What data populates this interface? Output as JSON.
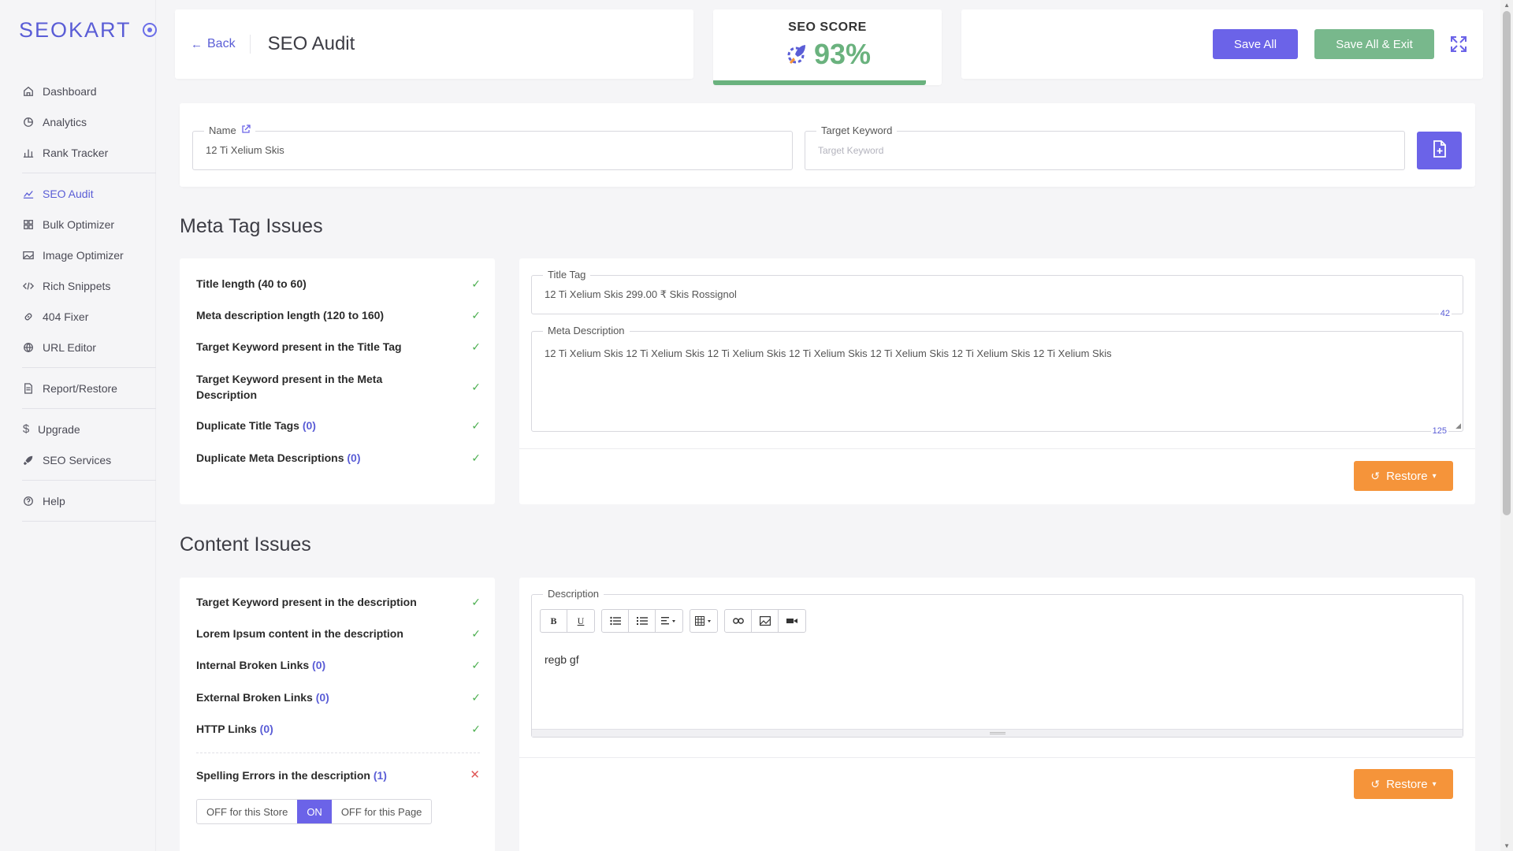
{
  "brand": {
    "logo_text": "SEOKART",
    "accent": "#6b63e8",
    "success": "#6ab27e",
    "warning": "#f5943a"
  },
  "sidebar": {
    "items": [
      {
        "label": "Dashboard",
        "icon": "home-icon"
      },
      {
        "label": "Analytics",
        "icon": "pie-chart-icon"
      },
      {
        "label": "Rank Tracker",
        "icon": "bar-chart-icon"
      },
      {
        "label": "SEO Audit",
        "icon": "line-chart-icon",
        "active": true
      },
      {
        "label": "Bulk Optimizer",
        "icon": "grid-icon"
      },
      {
        "label": "Image Optimizer",
        "icon": "image-icon"
      },
      {
        "label": "Rich Snippets",
        "icon": "code-icon"
      },
      {
        "label": "404 Fixer",
        "icon": "link-icon"
      },
      {
        "label": "URL Editor",
        "icon": "globe-icon"
      },
      {
        "label": "Report/Restore",
        "icon": "document-icon"
      },
      {
        "label": "Upgrade",
        "icon": "dollar-icon"
      },
      {
        "label": "SEO Services",
        "icon": "rocket-icon"
      },
      {
        "label": "Help",
        "icon": "help-icon"
      }
    ]
  },
  "header": {
    "back_label": "Back",
    "title": "SEO Audit",
    "score_label": "SEO SCORE",
    "score_value": "93%",
    "score_fraction": 0.93,
    "save_all": "Save All",
    "save_all_exit": "Save All & Exit"
  },
  "form": {
    "name_label": "Name",
    "name_value": "12 Ti Xelium Skis",
    "keyword_label": "Target Keyword",
    "keyword_placeholder": "Target Keyword"
  },
  "meta": {
    "section_title": "Meta Tag Issues",
    "issues": [
      {
        "text": "Title length (40 to 60)",
        "count": "",
        "status": "pass"
      },
      {
        "text": "Meta description length (120 to 160)",
        "count": "",
        "status": "pass"
      },
      {
        "text": "Target Keyword present in the Title Tag",
        "count": "",
        "status": "pass"
      },
      {
        "text": "Target Keyword present in the Meta Description",
        "count": "",
        "status": "pass"
      },
      {
        "text": "Duplicate Title Tags",
        "count": "(0)",
        "status": "pass"
      },
      {
        "text": "Duplicate Meta Descriptions",
        "count": "(0)",
        "status": "pass"
      }
    ],
    "title_tag_label": "Title Tag",
    "title_tag_value": "12 Ti Xelium Skis 299.00 ₹ Skis Rossignol",
    "title_tag_count": "42",
    "meta_desc_label": "Meta Description",
    "meta_desc_value": "12 Ti Xelium Skis 12 Ti Xelium Skis 12 Ti Xelium Skis 12 Ti Xelium Skis 12 Ti Xelium Skis 12 Ti Xelium Skis 12 Ti Xelium Skis",
    "meta_desc_count": "125",
    "restore_label": "Restore"
  },
  "content": {
    "section_title": "Content Issues",
    "issues": [
      {
        "text": "Target Keyword present in the description",
        "count": "",
        "status": "pass"
      },
      {
        "text": "Lorem Ipsum content in the description",
        "count": "",
        "status": "pass"
      },
      {
        "text": "Internal Broken Links",
        "count": "(0)",
        "status": "pass"
      },
      {
        "text": "External Broken Links",
        "count": "(0)",
        "status": "pass"
      },
      {
        "text": "HTTP Links",
        "count": "(0)",
        "status": "pass"
      }
    ],
    "spelling": {
      "text": "Spelling Errors in the description",
      "count": "(1)",
      "status": "fail"
    },
    "toggle": {
      "off_store": "OFF for this Store",
      "on": "ON",
      "off_page": "OFF for this Page"
    },
    "description_label": "Description",
    "description_value": "regb gf",
    "restore_label": "Restore"
  }
}
